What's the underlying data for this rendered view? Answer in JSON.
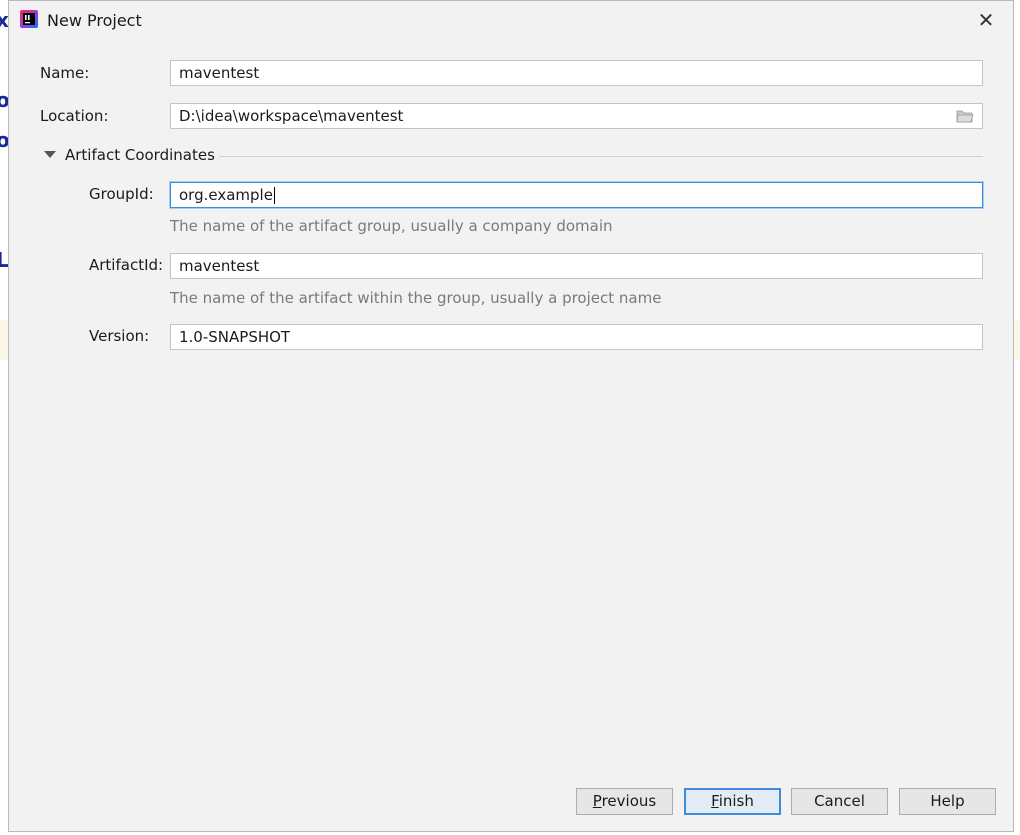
{
  "window": {
    "title": "New Project"
  },
  "form": {
    "name": {
      "label": "Name:",
      "value": "maventest"
    },
    "location": {
      "label": "Location:",
      "value": "D:\\idea\\workspace\\maventest"
    },
    "section": {
      "title": "Artifact Coordinates"
    },
    "group_id": {
      "label": "GroupId:",
      "value": "org.example",
      "hint": "The name of the artifact group, usually a company domain"
    },
    "artifact_id": {
      "label": "ArtifactId:",
      "value": "maventest",
      "hint": "The name of the artifact within the group, usually a project name"
    },
    "version": {
      "label": "Version:",
      "value": "1.0-SNAPSHOT"
    }
  },
  "buttons": {
    "previous": {
      "mnemonic": "P",
      "rest": "revious"
    },
    "finish": {
      "mnemonic": "F",
      "rest": "inish"
    },
    "cancel": "Cancel",
    "help": "Help"
  },
  "background_glyphs": [
    "x",
    "o",
    "o",
    "L"
  ],
  "icons": {
    "app": "intellij-idea-icon",
    "close": "close-icon",
    "folder": "folder-icon",
    "section": "triangle-down-icon"
  },
  "colors": {
    "accent": "#3d8bd9",
    "dialog_bg": "#f2f2f2"
  }
}
